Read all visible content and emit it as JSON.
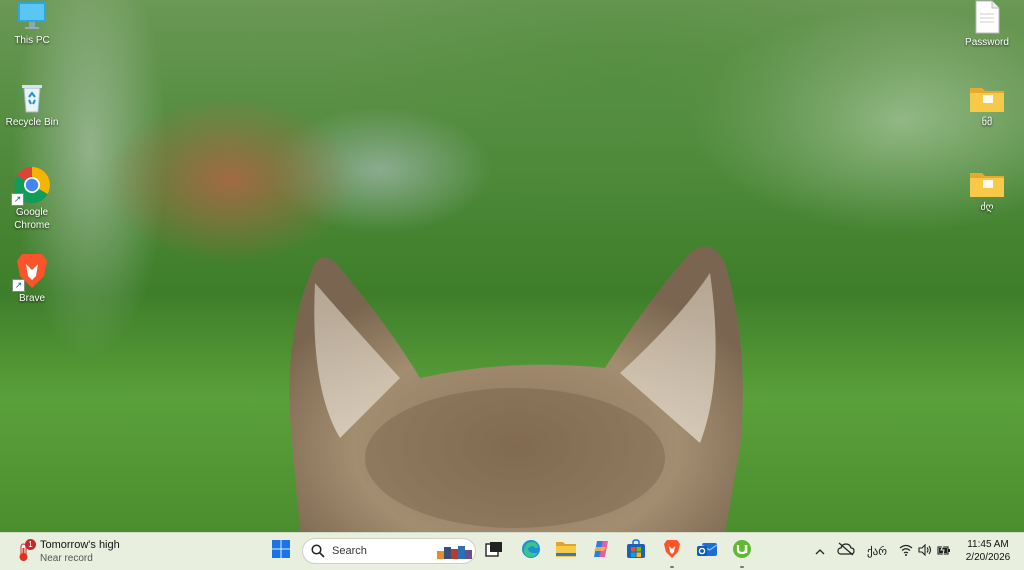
{
  "desktop": {
    "icons_left": [
      {
        "label": "This PC",
        "icon": "monitor-icon"
      },
      {
        "label": "Recycle Bin",
        "icon": "recycle-bin-icon"
      },
      {
        "label": "Google Chrome",
        "icon": "chrome-icon"
      },
      {
        "label": "Brave",
        "icon": "brave-icon"
      }
    ],
    "icons_right": [
      {
        "label": "Password",
        "icon": "document-icon"
      },
      {
        "label": "ნმ",
        "icon": "folder-icon"
      },
      {
        "label": "ძღ",
        "icon": "folder-icon"
      }
    ],
    "wallpaper": "cat-ears-in-garden"
  },
  "taskbar": {
    "weather": {
      "title": "Tomorrow's high",
      "subtitle": "Near record",
      "badge": "1"
    },
    "search_placeholder": "Search",
    "apps": [
      "start-icon",
      "search",
      "task-view-icon",
      "edge-icon",
      "file-explorer-icon",
      "copilot-icon",
      "microsoft-store-icon",
      "brave-icon",
      "outlook-icon",
      "utorrent-icon"
    ],
    "tray": {
      "language": "ქარ",
      "time": "11:45 AM",
      "date": "2/20/2026"
    }
  },
  "colors": {
    "taskbar_bg": "#e9efdf",
    "accent": "#1a73e8"
  }
}
